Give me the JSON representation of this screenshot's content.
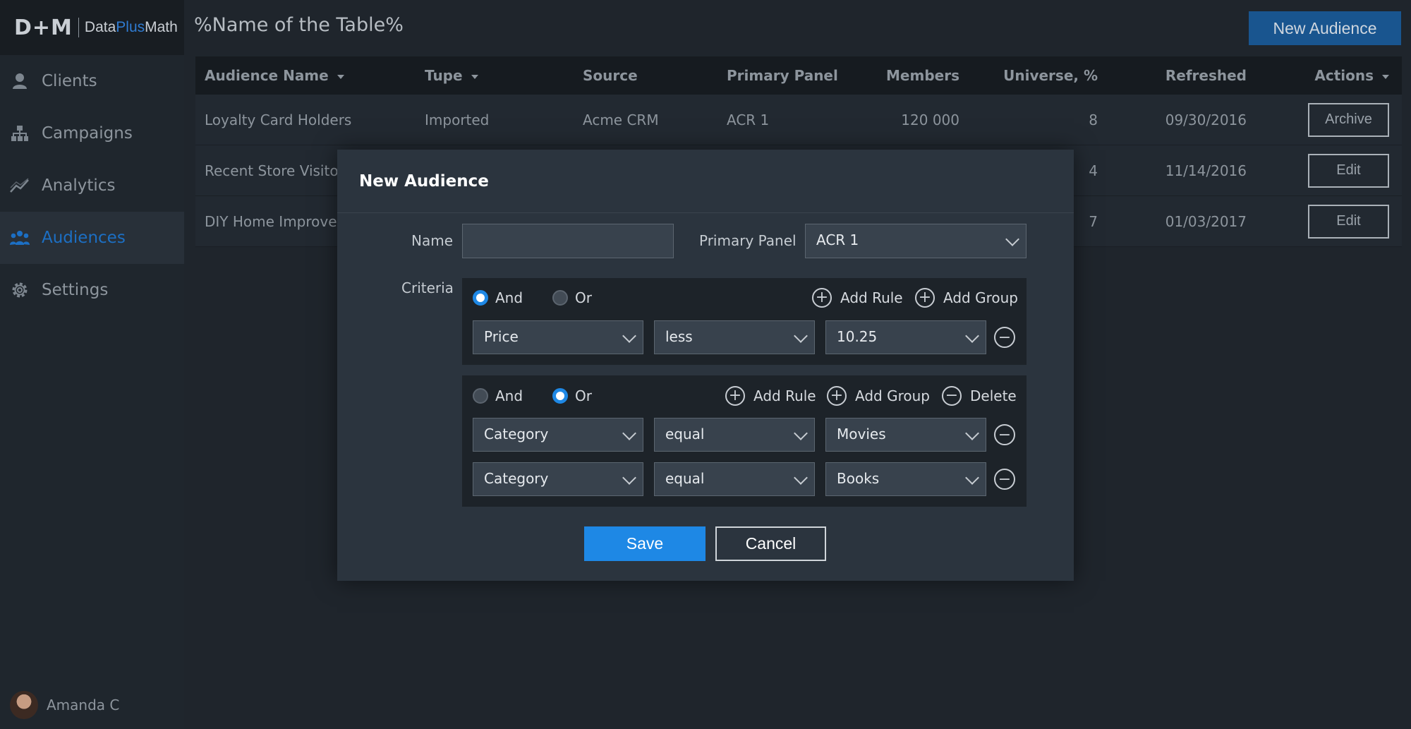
{
  "brand": {
    "mark": "D+M",
    "name_a": "Data",
    "name_b": "Plus",
    "name_c": "Math"
  },
  "sidebar": {
    "items": [
      {
        "label": "Clients",
        "icon": "user-icon"
      },
      {
        "label": "Campaigns",
        "icon": "hierarchy-icon"
      },
      {
        "label": "Analytics",
        "icon": "chart-line-icon"
      },
      {
        "label": "Audiences",
        "icon": "people-icon",
        "active": true
      },
      {
        "label": "Settings",
        "icon": "gear-icon"
      }
    ],
    "user": "Amanda C"
  },
  "header": {
    "title": "%Name of the Table%",
    "new_button": "New Audience"
  },
  "table": {
    "columns": [
      "Audience Name",
      "Tupe",
      "Source",
      "Primary Panel",
      "Members",
      "Universe, %",
      "Refreshed",
      "Actions"
    ],
    "rows": [
      {
        "name": "Loyalty Card Holders",
        "type": "Imported",
        "source": "Acme CRM",
        "panel": "ACR 1",
        "members": "120 000",
        "universe": "8",
        "refreshed": "09/30/2016",
        "action": "Archive"
      },
      {
        "name": "Recent Store Visitors",
        "type": "",
        "source": "",
        "panel": "",
        "members": "",
        "universe": "4",
        "refreshed": "11/14/2016",
        "action": "Edit"
      },
      {
        "name": "DIY Home Improver",
        "type": "",
        "source": "",
        "panel": "",
        "members": "",
        "universe": "7",
        "refreshed": "01/03/2017",
        "action": "Edit"
      }
    ]
  },
  "modal": {
    "title": "New Audience",
    "name_label": "Name",
    "name_value": "",
    "panel_label": "Primary Panel",
    "panel_value": "ACR 1",
    "criteria_label": "Criteria",
    "and_label": "And",
    "or_label": "Or",
    "add_rule": "Add Rule",
    "add_group": "Add Group",
    "delete": "Delete",
    "group1": {
      "mode": "And",
      "rules": [
        {
          "field": "Price",
          "op": "less",
          "value": "10.25"
        }
      ]
    },
    "group2": {
      "mode": "Or",
      "rules": [
        {
          "field": "Category",
          "op": "equal",
          "value": "Movies"
        },
        {
          "field": "Category",
          "op": "equal",
          "value": "Books"
        }
      ]
    },
    "save": "Save",
    "cancel": "Cancel"
  },
  "colors": {
    "accent": "#1e88e5",
    "active_nav": "#1c6fc4",
    "sidebar_bg": "#1f262d",
    "modal_bg": "#2b343e"
  }
}
